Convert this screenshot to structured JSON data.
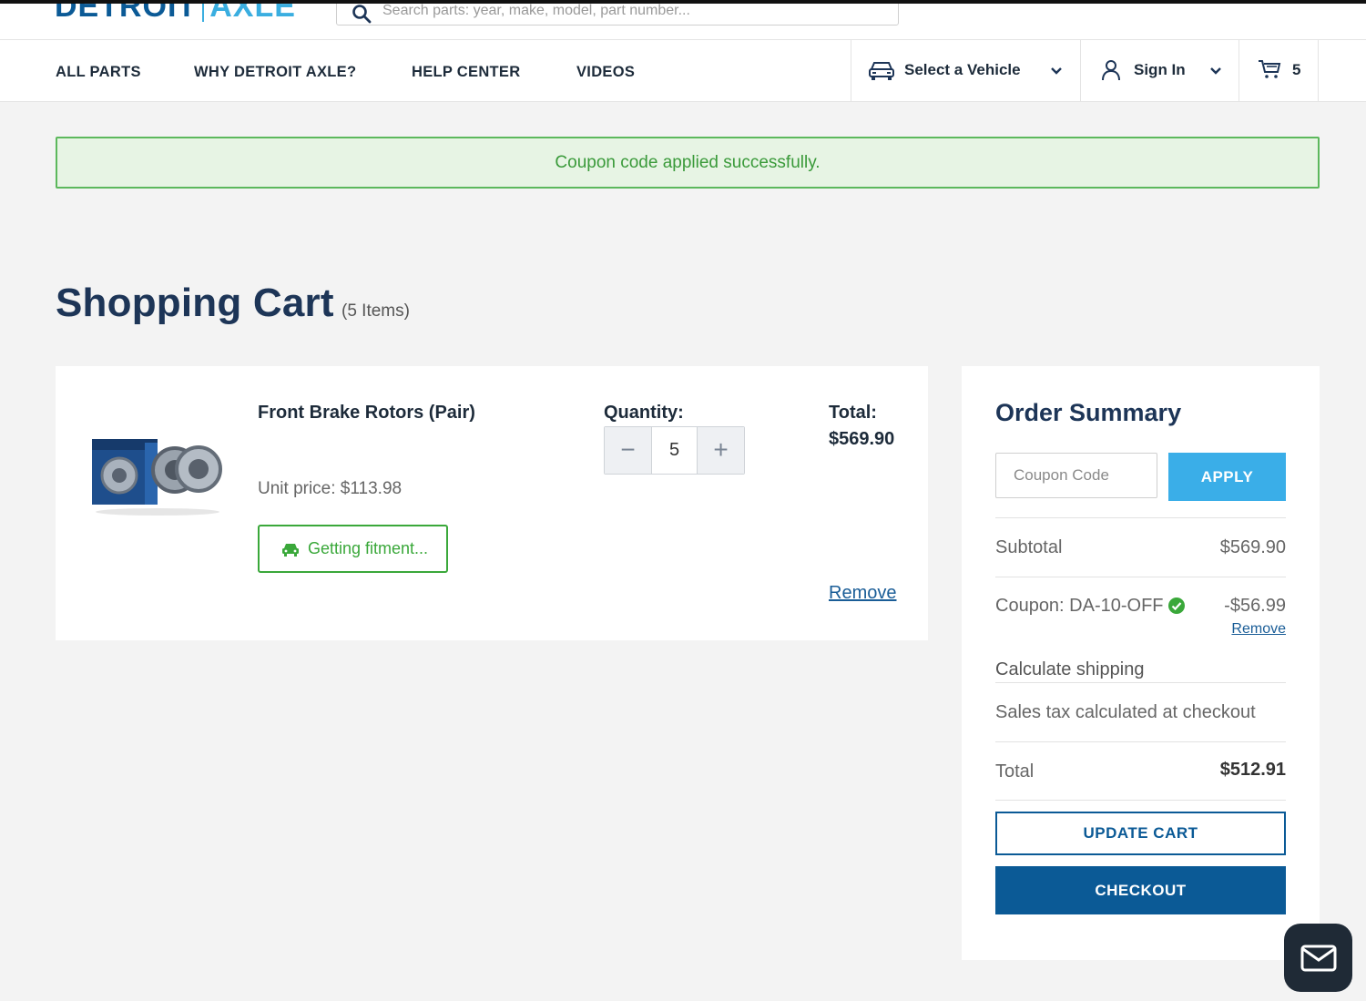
{
  "brand": {
    "logo_part1": "DETROIT",
    "logo_part2": "AXLE",
    "accent": "#3aaee0",
    "primary": "#0b5a96"
  },
  "search": {
    "placeholder": "Search parts: year, make, model, part number..."
  },
  "nav": {
    "links": [
      "ALL PARTS",
      "WHY DETROIT AXLE?",
      "HELP CENTER",
      "VIDEOS"
    ],
    "vehicle_label": "Select a Vehicle",
    "signin_label": "Sign In",
    "cart_count": "5"
  },
  "alert": {
    "message": "Coupon code applied successfully.",
    "color": "#5cb85c"
  },
  "page": {
    "title": "Shopping Cart",
    "item_count": "(5 Items)"
  },
  "cart_items": [
    {
      "name": "Front Brake Rotors (Pair)",
      "unit_price": "Unit price: $113.98",
      "fitment_label": "Getting fitment...",
      "quantity_label": "Quantity:",
      "quantity": "5",
      "total_label": "Total:",
      "total": "$569.90",
      "remove_label": "Remove"
    }
  ],
  "summary": {
    "title": "Order Summary",
    "coupon_placeholder": "Coupon Code",
    "apply_label": "APPLY",
    "subtotal_label": "Subtotal",
    "subtotal": "$569.90",
    "coupon_label": "Coupon: DA-10-OFF",
    "coupon_discount": "-$56.99",
    "coupon_remove_label": "Remove",
    "shipping_label": "Calculate shipping",
    "tax_label": "Sales tax calculated at checkout",
    "total_label": "Total",
    "total": "$512.91",
    "update_label": "UPDATE CART",
    "checkout_label": "CHECKOUT"
  },
  "icons": {
    "search": "search-icon",
    "car": "car-icon",
    "user": "user-icon",
    "cart": "cart-icon",
    "check": "check-circle-icon",
    "mail": "mail-icon"
  }
}
